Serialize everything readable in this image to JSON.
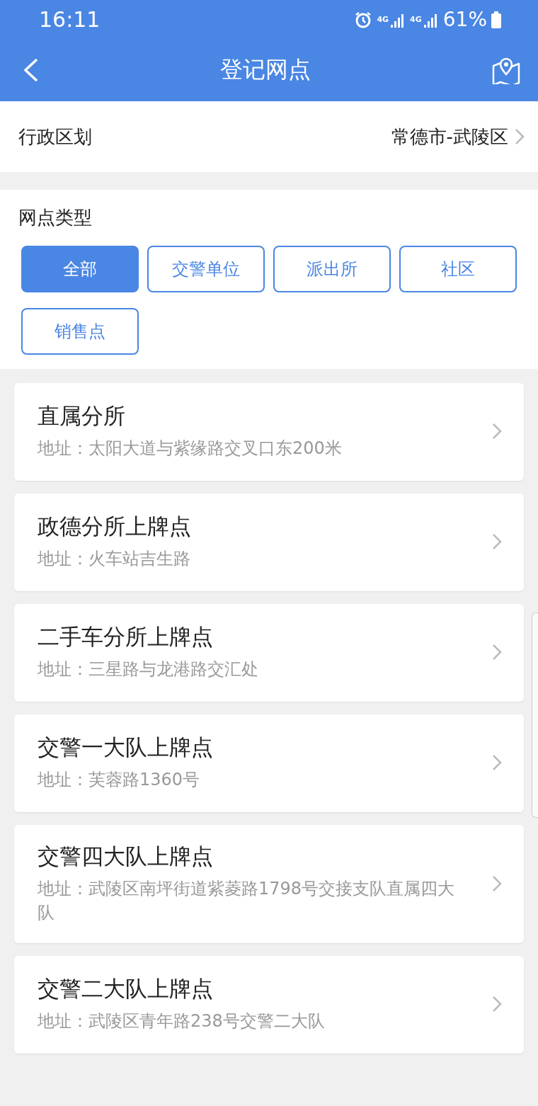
{
  "status_bar": {
    "time": "16:11",
    "network_1": "4G",
    "network_2": "4G",
    "battery": "61%"
  },
  "header": {
    "title": "登记网点"
  },
  "region": {
    "label": "行政区划",
    "value": "常德市-武陵区"
  },
  "filter": {
    "label": "网点类型",
    "options": [
      {
        "label": "全部",
        "selected": true
      },
      {
        "label": "交警单位",
        "selected": false
      },
      {
        "label": "派出所",
        "selected": false
      },
      {
        "label": "社区",
        "selected": false
      },
      {
        "label": "销售点",
        "selected": false
      }
    ]
  },
  "sites": [
    {
      "name": "直属分所",
      "address": "地址：太阳大道与紫缘路交叉口东200米"
    },
    {
      "name": "政德分所上牌点",
      "address": "地址：火车站吉生路"
    },
    {
      "name": "二手车分所上牌点",
      "address": "地址：三星路与龙港路交汇处"
    },
    {
      "name": "交警一大队上牌点",
      "address": "地址：芙蓉路1360号"
    },
    {
      "name": "交警四大队上牌点",
      "address": "地址：武陵区南坪街道紫菱路1798号交接支队直属四大队"
    },
    {
      "name": "交警二大队上牌点",
      "address": "地址：武陵区青年路238号交警二大队"
    }
  ]
}
